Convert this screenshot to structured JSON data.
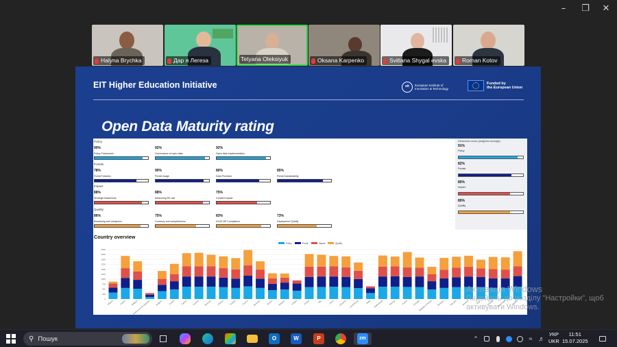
{
  "participants": [
    {
      "name": "Halyna Brychka",
      "bg": "#c9c4bd"
    },
    {
      "name": "Дар я Легеза",
      "bg": "#5fc69a"
    },
    {
      "name": "Tetyana Oleksiyuk",
      "bg": "#b9b2a8"
    },
    {
      "name": "Oksana Karpenko",
      "bg": "#8f867c"
    },
    {
      "name": "Svitlana Shygal evska",
      "bg": "#e9e9eb"
    },
    {
      "name": "Roman Kotov",
      "bg": "#d7d5d0"
    }
  ],
  "slide": {
    "header": "EIT Higher Education Initiative",
    "eit_text_1": "European Institute of",
    "eit_text_2": "Innovation & Technology",
    "eit_mark": "eit",
    "eu_text_1": "Funded by",
    "eu_text_2": "the European Union",
    "title": "Open Data Maturity rating"
  },
  "dashboard": {
    "sections": [
      "Policy",
      "Portals",
      "Impact",
      "Quality"
    ],
    "kpis": [
      [
        {
          "pct": "90%",
          "name": "Policy Framework",
          "value": 0.9,
          "color": "#1ba8e6"
        },
        {
          "pct": "92%",
          "name": "Governance of open data",
          "value": 0.92,
          "color": "#1ba8e6"
        },
        {
          "pct": "92%",
          "name": "Open data implementation",
          "value": 0.92,
          "color": "#1ba8e6"
        }
      ],
      [
        {
          "pct": "78%",
          "name": "Portal Features",
          "value": 0.78,
          "color": "#0f1f8a"
        },
        {
          "pct": "90%",
          "name": "Portal Usage",
          "value": 0.9,
          "color": "#0f1f8a"
        },
        {
          "pct": "80%",
          "name": "Data Provision",
          "value": 0.8,
          "color": "#0f1f8a"
        },
        {
          "pct": "85%",
          "name": "Portal Sustainability",
          "value": 0.85,
          "color": "#0f1f8a"
        }
      ],
      [
        {
          "pct": "88%",
          "name": "Strategic Awareness",
          "value": 0.88,
          "color": "#e0504a"
        },
        {
          "pct": "88%",
          "name": "Measuring Re-use",
          "value": 0.88,
          "color": "#e0504a"
        },
        {
          "pct": "75%",
          "name": "Created impact",
          "value": 0.75,
          "color": "#e0504a"
        }
      ],
      [
        {
          "pct": "86%",
          "name": "Monitoring and measures",
          "value": 0.86,
          "color": "#f5a03c"
        },
        {
          "pct": "75%",
          "name": "Currency and completeness",
          "value": 0.75,
          "color": "#f5a03c"
        },
        {
          "pct": "83%",
          "name": "DCAT-AP Compliance",
          "value": 0.83,
          "color": "#f5a03c"
        },
        {
          "pct": "73%",
          "name": "Deployment Quality",
          "value": 0.73,
          "color": "#f5a03c"
        }
      ]
    ],
    "dim_title": "Dimension score (weighted average)",
    "dims": [
      {
        "pct": "91%",
        "name": "Policy",
        "value": 0.91,
        "color": "#1ba8e6"
      },
      {
        "pct": "82%",
        "name": "Portals",
        "value": 0.82,
        "color": "#0f1f8a"
      },
      {
        "pct": "80%",
        "name": "Impact",
        "value": 0.8,
        "color": "#e0504a"
      },
      {
        "pct": "80%",
        "name": "Quality",
        "value": 0.8,
        "color": "#f5a03c"
      }
    ],
    "overview_title": "Country overview"
  },
  "chart_data": {
    "type": "bar",
    "stacked": true,
    "title": "Country overview",
    "ylim": [
      0,
      2500
    ],
    "yticks": [
      "0",
      "250",
      "500",
      "750",
      "1000",
      "1250",
      "1500",
      "1750",
      "2000",
      "2250",
      "2500"
    ],
    "categories": [
      "Albania",
      "Austria",
      "Belgium",
      "Bosnia and Herzegovina",
      "Bulgaria",
      "Croatia",
      "Cyprus",
      "Czechia",
      "Denmark",
      "Estonia",
      "Finland",
      "France",
      "Germany",
      "Greece",
      "Hungary",
      "Iceland",
      "Ireland",
      "Italy",
      "Latvia",
      "Lithuania",
      "Luxembourg",
      "Malta",
      "Netherlands",
      "Norway",
      "Poland",
      "Portugal",
      "Republic of Serbia",
      "Romania",
      "Slovakia",
      "Slovenia",
      "Spain",
      "Sweden",
      "Switzerland",
      "Ukraine"
    ],
    "series": [
      {
        "name": "Policy",
        "color": "#1ba8e6",
        "values": [
          330,
          560,
          520,
          100,
          400,
          480,
          620,
          620,
          620,
          600,
          560,
          640,
          560,
          450,
          480,
          420,
          600,
          610,
          620,
          600,
          550,
          300,
          620,
          620,
          610,
          600,
          480,
          560,
          600,
          610,
          600,
          560,
          560,
          620
        ]
      },
      {
        "name": "Portal",
        "color": "#0f1f8a",
        "values": [
          250,
          500,
          450,
          120,
          320,
          420,
          520,
          520,
          520,
          480,
          470,
          540,
          470,
          320,
          350,
          360,
          520,
          530,
          520,
          520,
          460,
          240,
          520,
          530,
          510,
          540,
          420,
          480,
          500,
          520,
          510,
          480,
          480,
          540
        ]
      },
      {
        "name": "Impact",
        "color": "#e0504a",
        "values": [
          200,
          500,
          420,
          80,
          300,
          360,
          520,
          520,
          520,
          480,
          470,
          520,
          460,
          280,
          250,
          160,
          520,
          500,
          520,
          480,
          420,
          100,
          500,
          500,
          480,
          440,
          350,
          440,
          480,
          500,
          440,
          470,
          450,
          500
        ]
      },
      {
        "name": "Quality",
        "color": "#f5a03c",
        "values": [
          100,
          620,
          520,
          0,
          400,
          520,
          660,
          680,
          580,
          600,
          570,
          780,
          420,
          250,
          210,
          0,
          640,
          600,
          520,
          560,
          420,
          0,
          560,
          500,
          780,
          520,
          380,
          600,
          560,
          560,
          440,
          620,
          620,
          760
        ]
      }
    ]
  },
  "watermark": {
    "line1": "Активація Windows",
    "line2": "Перейдіть до розділу \"Настройки\", щоб",
    "line3": "активувати Windows."
  },
  "taskbar": {
    "search_label": "Пошук",
    "lang_1": "УКР",
    "lang_2": "UKR",
    "time": "11:51",
    "date": "15.07.2025"
  }
}
